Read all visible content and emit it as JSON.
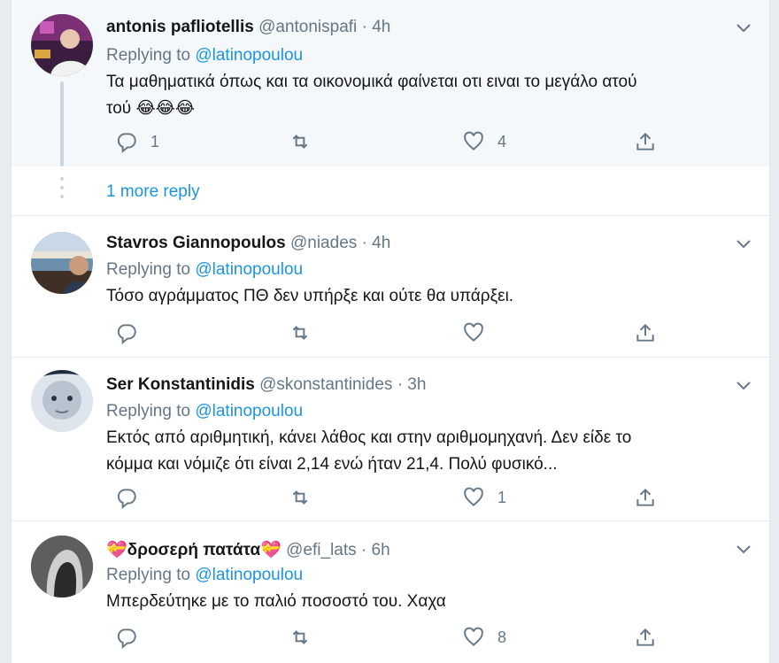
{
  "tweets": [
    {
      "name": "antonis pafliotellis",
      "handle": "@antonispafi",
      "dot": "·",
      "time": "4h",
      "replying_prefix": "Replying to",
      "replying_to": "@latinopoulou",
      "text_line1": "Τα μαθηματικά όπως και τα οικονομικά φαίνεται οτι ειναι το μεγάλο ατού",
      "text_line2": "τού 😂😂😂",
      "replies": "1",
      "retweets": "",
      "likes": "4"
    },
    {
      "name": "Stavros Giannopoulos",
      "handle": "@niades",
      "dot": "·",
      "time": "4h",
      "replying_prefix": "Replying to",
      "replying_to": "@latinopoulou",
      "text_line1": "Τόσο αγράμματος ΠΘ δεν υπήρξε και ούτε θα υπάρξει.",
      "replies": "",
      "retweets": "",
      "likes": ""
    },
    {
      "name": "Ser Konstantinidis",
      "handle": "@skonstantinides",
      "dot": "·",
      "time": "3h",
      "replying_prefix": "Replying to",
      "replying_to": "@latinopoulou",
      "text_line1": "Εκτός από αριθμητική, κάνει λάθος και στην αριθμομηχανή. Δεν είδε το",
      "text_line2": "κόμμα και νόμιζε ότι είναι 2,14 ενώ ήταν 21,4. Πολύ φυσικό...",
      "replies": "",
      "retweets": "",
      "likes": "1"
    },
    {
      "name_prefix": "💝",
      "name": "δροσερή πατάτα",
      "name_suffix": "💝",
      "handle": "@efi_lats",
      "dot": "·",
      "time": "6h",
      "replying_prefix": "Replying to",
      "replying_to": "@latinopoulou",
      "text_line1": "Μπερδεύτηκε με το παλιό ποσοστό του. Χαχα",
      "replies": "",
      "retweets": "",
      "likes": "8"
    }
  ],
  "more_replies": "1 more reply",
  "icons": {
    "reply": "reply-icon",
    "retweet": "retweet-icon",
    "like": "heart-icon",
    "share": "share-icon",
    "caret": "chevron-down-icon"
  },
  "colors": {
    "link": "#1b95e0",
    "muted": "#657786",
    "background": "#e6ecf0"
  }
}
